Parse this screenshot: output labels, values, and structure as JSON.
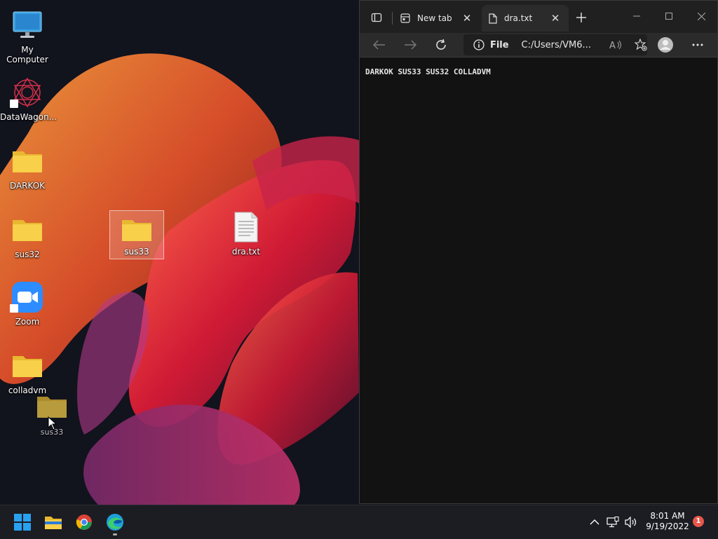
{
  "desktop": {
    "icons": [
      {
        "label": "My Computer"
      },
      {
        "label": "DataWagon..."
      },
      {
        "label": "DARKOK"
      },
      {
        "label": "sus32"
      },
      {
        "label": "sus33"
      },
      {
        "label": "dra.txt"
      },
      {
        "label": "Zoom"
      },
      {
        "label": "colladvm"
      }
    ],
    "drag_ghost": {
      "label": "sus33"
    }
  },
  "browser": {
    "tabs": [
      {
        "label": "New tab"
      },
      {
        "label": "dra.txt",
        "active": true
      }
    ],
    "address": {
      "scheme_label": "File",
      "url": "C:/Users/VM6..."
    },
    "document_text": "DARKOK SUS33 SUS32 COLLADVM"
  },
  "taskbar": {
    "apps": [
      "start",
      "file-explorer",
      "chrome",
      "edge"
    ],
    "clock": {
      "time": "8:01 AM",
      "date": "9/19/2022"
    },
    "notification_count": "1"
  },
  "colors": {
    "accent_blue": "#0078d4",
    "folder_yellow": "#f8d04a",
    "badge_red": "#e8574b"
  }
}
